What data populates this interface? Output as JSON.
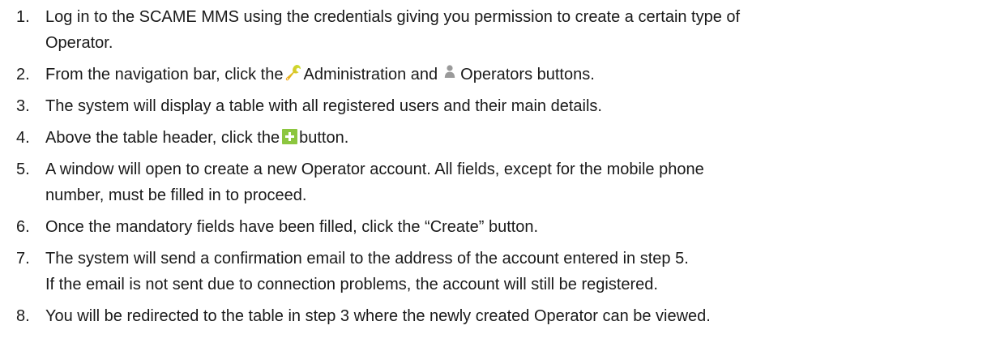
{
  "steps": [
    {
      "number": "1.",
      "lines": [
        "Log in to the SCAME MMS using the credentials giving you permission to create a certain type of",
        "Operator."
      ]
    },
    {
      "number": "2.",
      "part1": "From the navigation bar, click the",
      "part2": "Administration and",
      "part3": "Operators buttons."
    },
    {
      "number": "3.",
      "lines": [
        "The system will display a table with all registered users and their main details."
      ]
    },
    {
      "number": "4.",
      "part1": "Above the table header, click the",
      "part2": "button."
    },
    {
      "number": "5.",
      "lines": [
        "A window will open to create a new Operator account. All fields, except for the mobile phone",
        "number, must be filled in to proceed."
      ]
    },
    {
      "number": "6.",
      "lines": [
        "Once the mandatory fields have been filled, click the “Create” button."
      ]
    },
    {
      "number": "7.",
      "lines": [
        "The system will send a confirmation email to the address of the account entered in step 5.",
        "If the email is not sent due to connection problems, the account will still be registered."
      ]
    },
    {
      "number": "8.",
      "lines": [
        "You will be redirected to the table in step 3 where the newly created Operator can be viewed."
      ]
    }
  ],
  "icons": {
    "administration": "wrench-icon",
    "operators": "user-icon",
    "add": "plus-icon"
  },
  "colors": {
    "text": "#1a1a1a",
    "wrench_gradient_top": "#c6e334",
    "wrench_gradient_bottom": "#f2a51a",
    "user_icon": "#9a9a9a",
    "plus_button": "#8cc63f"
  }
}
